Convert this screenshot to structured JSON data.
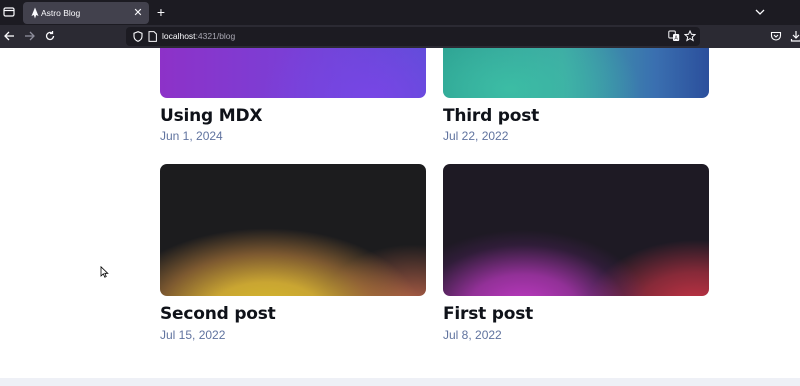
{
  "browser": {
    "tab_title": "Astro Blog",
    "tab_close": "✕",
    "new_tab": "+",
    "url_host": "localhost",
    "url_rest": ":4321/blog"
  },
  "posts": [
    {
      "title": "Using MDX",
      "date": "Jun 1, 2024"
    },
    {
      "title": "Third post",
      "date": "Jul 22, 2022"
    },
    {
      "title": "Second post",
      "date": "Jul 15, 2022"
    },
    {
      "title": "First post",
      "date": "Jul 8, 2022"
    }
  ],
  "colors": {
    "chrome_dark": "#1c1b22",
    "toolbar": "#2b2a33",
    "title_text": "#0f1219",
    "date_text": "#60739f"
  }
}
